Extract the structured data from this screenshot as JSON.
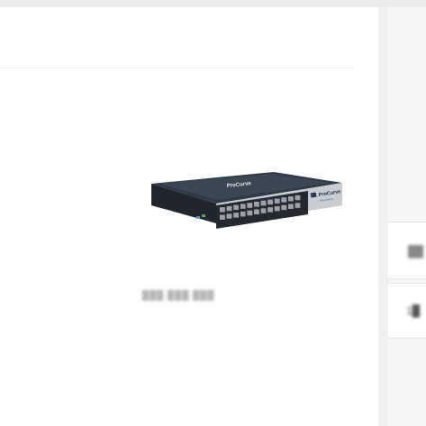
{
  "product": {
    "image_alt": "ProCurve 24-port network switch",
    "brand_top": "ProCurve",
    "brand_front": "ProCurve",
    "brand_front_sub": "Networking",
    "caption": "███ ███ ███"
  },
  "side": {
    "card1_text": "██",
    "card2_text": "1█"
  },
  "colors": {
    "switch_body": "#2f3a46",
    "switch_front": "#1f252c",
    "port": "#9aa3ad"
  }
}
